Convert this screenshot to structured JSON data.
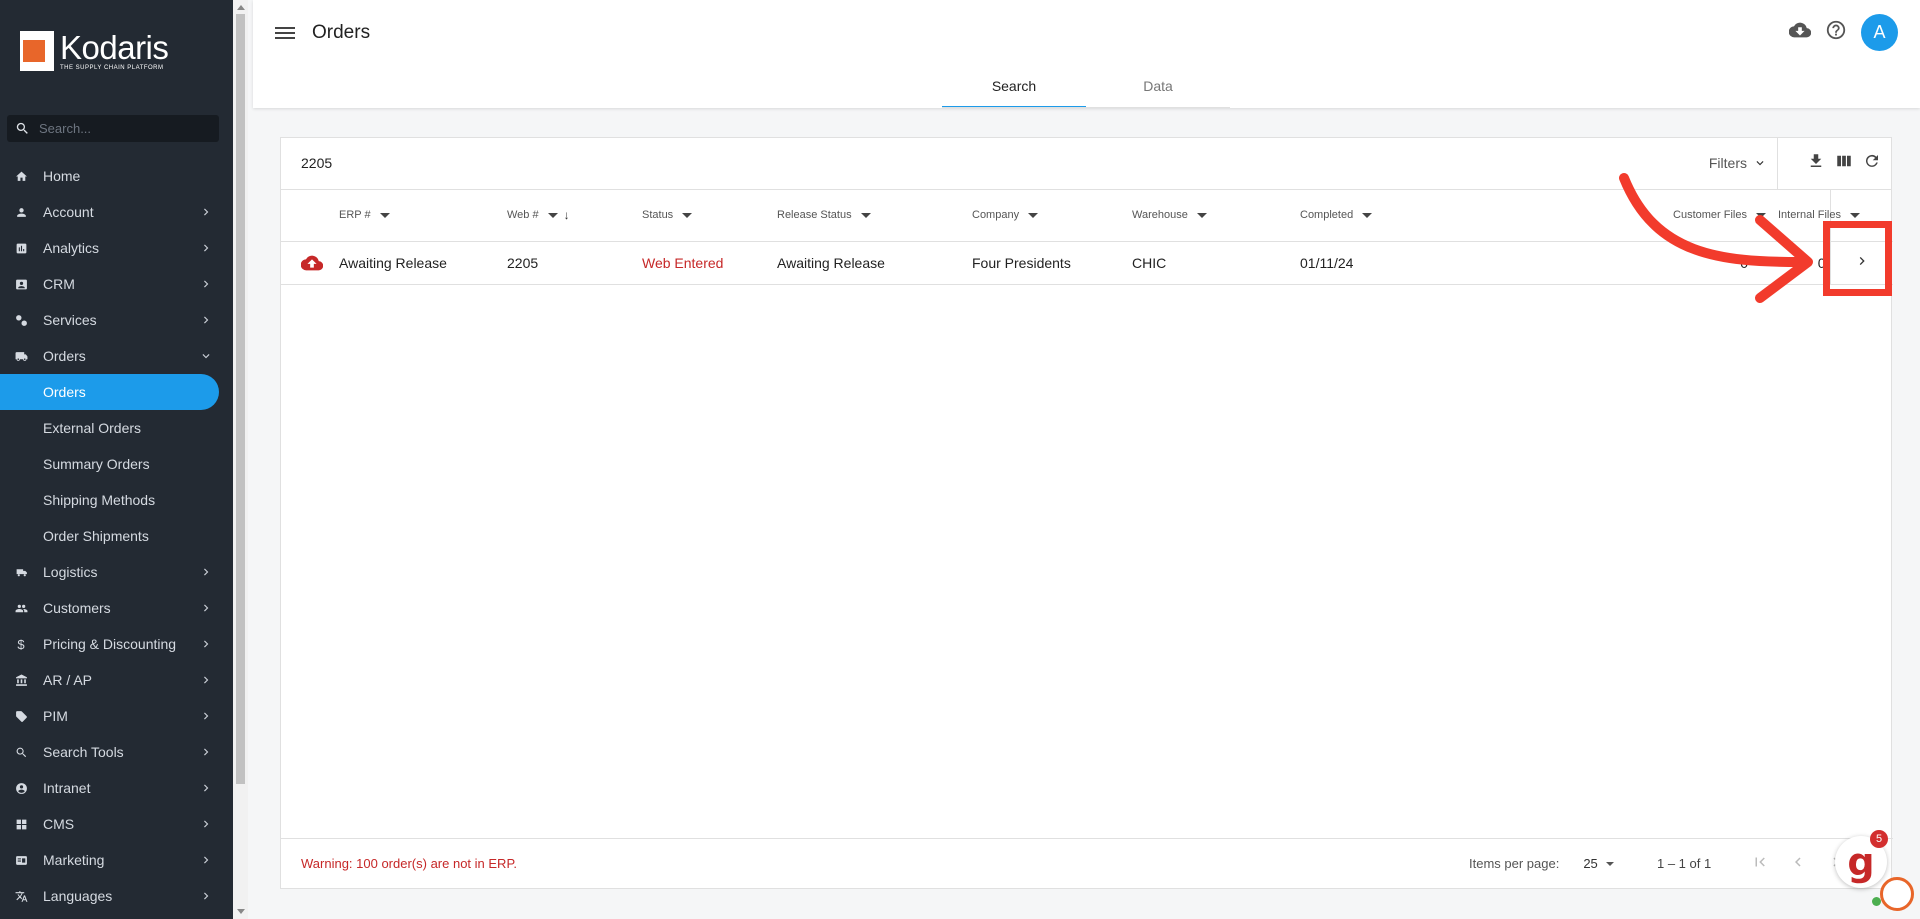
{
  "brand": {
    "name": "Kodaris",
    "tagline": "THE SUPPLY CHAIN PLATFORM"
  },
  "sidebar": {
    "search_placeholder": "Search...",
    "items": [
      {
        "label": "Home",
        "icon": "home-icon"
      },
      {
        "label": "Account",
        "icon": "person-icon"
      },
      {
        "label": "Analytics",
        "icon": "analytics-icon"
      },
      {
        "label": "CRM",
        "icon": "contact-icon"
      },
      {
        "label": "Services",
        "icon": "services-icon"
      },
      {
        "label": "Orders",
        "icon": "truck-icon"
      },
      {
        "label": "Orders"
      },
      {
        "label": "External Orders"
      },
      {
        "label": "Summary Orders"
      },
      {
        "label": "Shipping Methods"
      },
      {
        "label": "Order Shipments"
      },
      {
        "label": "Logistics",
        "icon": "logistics-icon"
      },
      {
        "label": "Customers",
        "icon": "people-icon"
      },
      {
        "label": "Pricing & Discounting",
        "icon": "dollar-icon"
      },
      {
        "label": "AR / AP",
        "icon": "bank-icon"
      },
      {
        "label": "PIM",
        "icon": "tag-icon"
      },
      {
        "label": "Search Tools",
        "icon": "search-tools-icon"
      },
      {
        "label": "Intranet",
        "icon": "intranet-icon"
      },
      {
        "label": "CMS",
        "icon": "cms-icon"
      },
      {
        "label": "Marketing",
        "icon": "marketing-icon"
      },
      {
        "label": "Languages",
        "icon": "translate-icon"
      }
    ]
  },
  "header": {
    "title": "Orders",
    "avatar_initial": "A"
  },
  "tabs": [
    {
      "label": "Search"
    },
    {
      "label": "Data"
    }
  ],
  "search": {
    "query": "2205",
    "filters_label": "Filters"
  },
  "table": {
    "columns": [
      "ERP #",
      "Web #",
      "Status",
      "Release Status",
      "Company",
      "Warehouse",
      "Completed",
      "Customer Files",
      "Internal Files"
    ],
    "rows": [
      {
        "erp": "Awaiting Release",
        "web": "2205",
        "status": "Web Entered",
        "release_status": "Awaiting Release",
        "company": "Four Presidents",
        "warehouse": "CHIC",
        "completed": "01/11/24",
        "customer_files": "0",
        "internal_files": "0"
      }
    ]
  },
  "footer": {
    "warning": "Warning: 100 order(s) are not in ERP.",
    "items_per_page_label": "Items per page:",
    "items_per_page": "25",
    "range": "1 – 1 of 1"
  },
  "help_widget": {
    "count": "5",
    "letter": "g"
  },
  "colors": {
    "accent": "#1c9bea",
    "sidebar_bg": "#232a33",
    "error": "#c62828",
    "annotation": "#f23b2c"
  }
}
